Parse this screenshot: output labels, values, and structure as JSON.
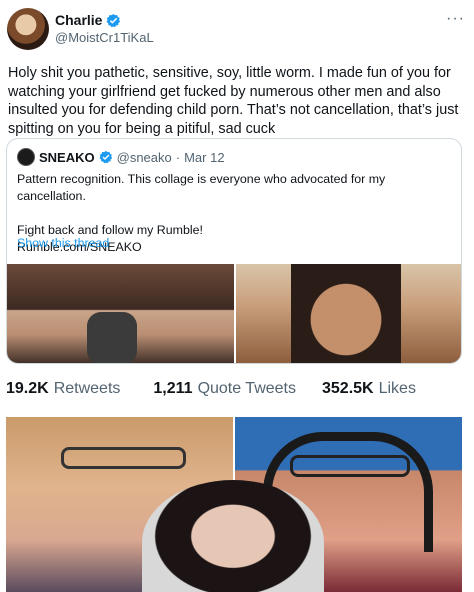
{
  "tweet": {
    "author_name": "Charlie",
    "author_handle": "@MoistCr1TiKaL",
    "more_glyph": "···",
    "text": "Holy shit you pathetic, sensitive, soy, little worm. I made fun of you for watching your girlfriend get fucked by numerous other men and also insulted you for defending child porn. That’s not cancellation, that’s just spitting on you for being a pitiful, sad cuck"
  },
  "quote": {
    "author_name": "SNEAKO",
    "author_handle": "@sneako",
    "separator": "·",
    "date": "Mar 12",
    "line1": "Pattern recognition. This collage is everyone who advocated for my cancellation.",
    "line2": "Fight back and follow my Rumble!",
    "line3": "Rumble.com/SNEAKO",
    "show_thread": "Show this thread"
  },
  "stats": {
    "retweets_count": "19.2K",
    "retweets_label": "Retweets",
    "quotes_count": "1,211",
    "quotes_label": "Quote Tweets",
    "likes_count": "352.5K",
    "likes_label": "Likes"
  },
  "colors": {
    "verified": "#1d9bf0",
    "link": "#1d9bf0",
    "secondary_text": "#536471",
    "border": "#cfd9de"
  }
}
